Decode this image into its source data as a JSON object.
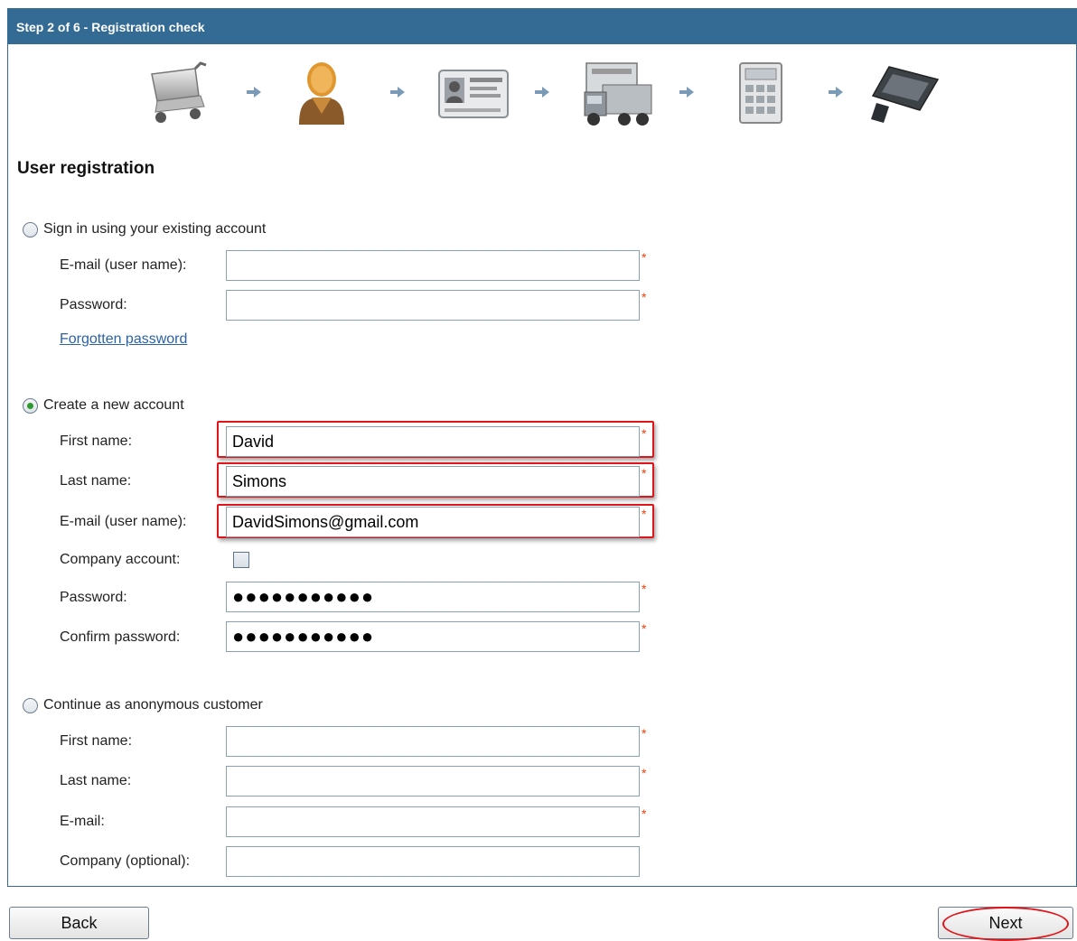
{
  "header": {
    "title": "Step 2 of 6 - Registration check"
  },
  "steps": [
    {
      "icon": "shopping-cart-icon"
    },
    {
      "icon": "user-icon"
    },
    {
      "icon": "id-card-icon"
    },
    {
      "icon": "delivery-truck-icon"
    },
    {
      "icon": "calculator-icon"
    },
    {
      "icon": "card-payment-icon"
    }
  ],
  "page": {
    "section_title": "User registration"
  },
  "signin": {
    "radio_label": "Sign in using your existing account",
    "email_label": "E-mail (user name):",
    "email_value": "",
    "password_label": "Password:",
    "password_value": "",
    "forgot_link": "Forgotten password"
  },
  "create": {
    "radio_label": "Create a new account",
    "first_name_label": "First name:",
    "first_name_value": "David",
    "last_name_label": "Last name:",
    "last_name_value": "Simons",
    "email_label": "E-mail (user name):",
    "email_value": "DavidSimons@gmail.com",
    "company_label": "Company account:",
    "password_label": "Password:",
    "password_value": "●●●●●●●●●●●",
    "confirm_label": "Confirm password:",
    "confirm_value": "●●●●●●●●●●●"
  },
  "anon": {
    "radio_label": "Continue as anonymous customer",
    "first_name_label": "First name:",
    "first_name_value": "",
    "last_name_label": "Last name:",
    "last_name_value": "",
    "email_label": "E-mail:",
    "email_value": "",
    "company_label": "Company (optional):",
    "company_value": ""
  },
  "required_mark": "*",
  "buttons": {
    "back": "Back",
    "next": "Next"
  },
  "colors": {
    "header_bg": "#336b95",
    "highlight": "#e0151a",
    "required": "#ff3a00",
    "link": "#2c62a6"
  }
}
